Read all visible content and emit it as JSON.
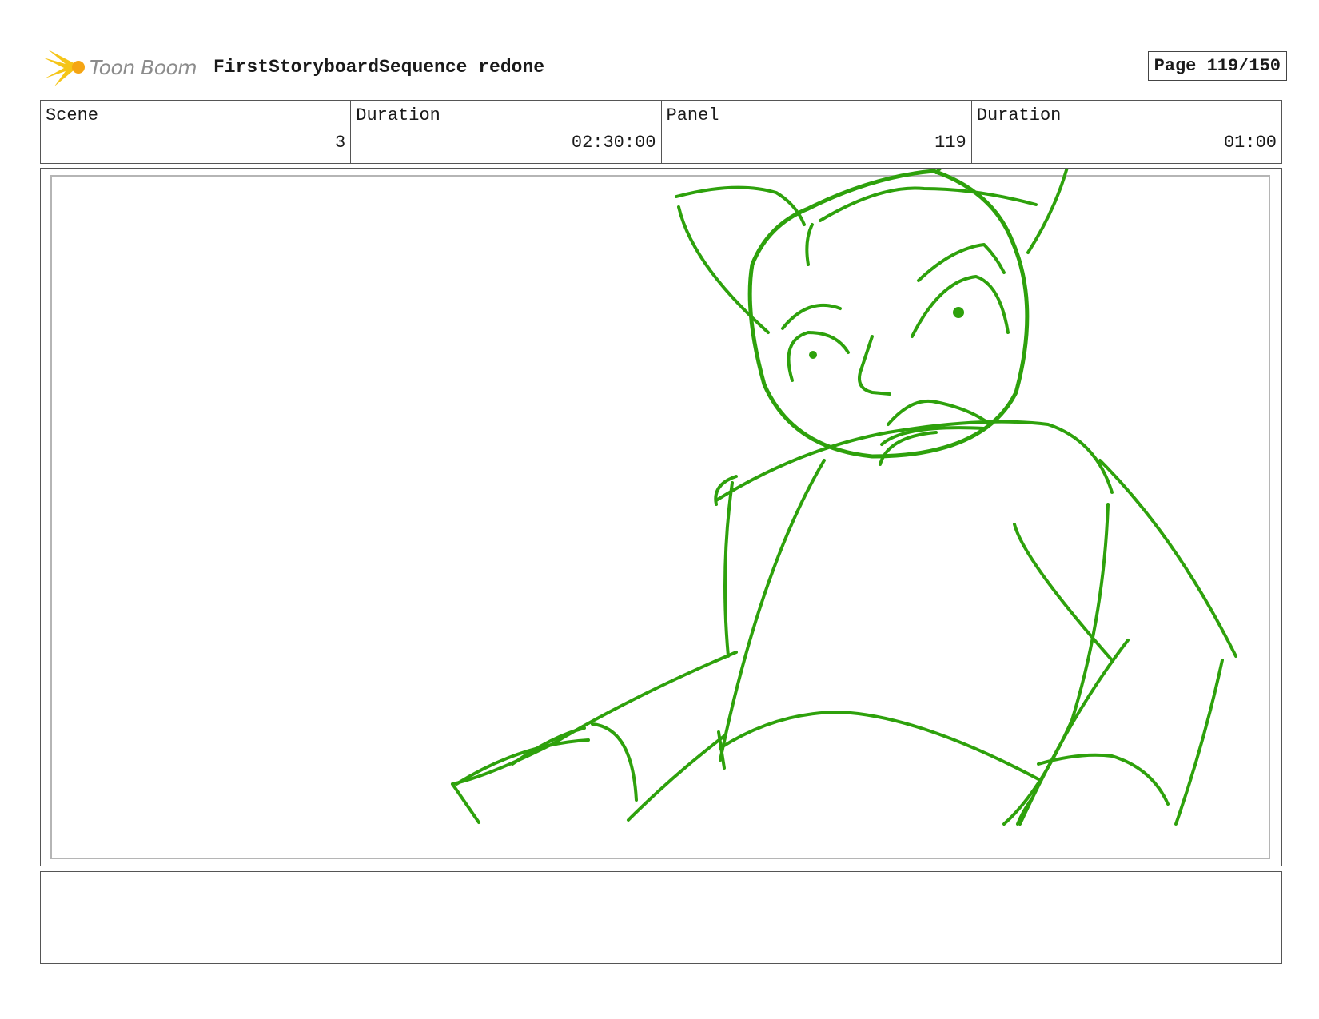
{
  "header": {
    "logo_text": "Toon Boom",
    "title": "FirstStoryboardSequence redone",
    "page_label": "Page 119/150"
  },
  "info": {
    "scene_label": "Scene",
    "scene_value": "3",
    "scene_duration_label": "Duration",
    "scene_duration_value": "02:30:00",
    "panel_label": "Panel",
    "panel_value": "119",
    "panel_duration_label": "Duration",
    "panel_duration_value": "01:00"
  },
  "caption": {
    "text": ""
  },
  "colors": {
    "sketch": "#2ea10c",
    "logo_yellow": "#f5c518",
    "logo_text": "#8c8c8c"
  }
}
